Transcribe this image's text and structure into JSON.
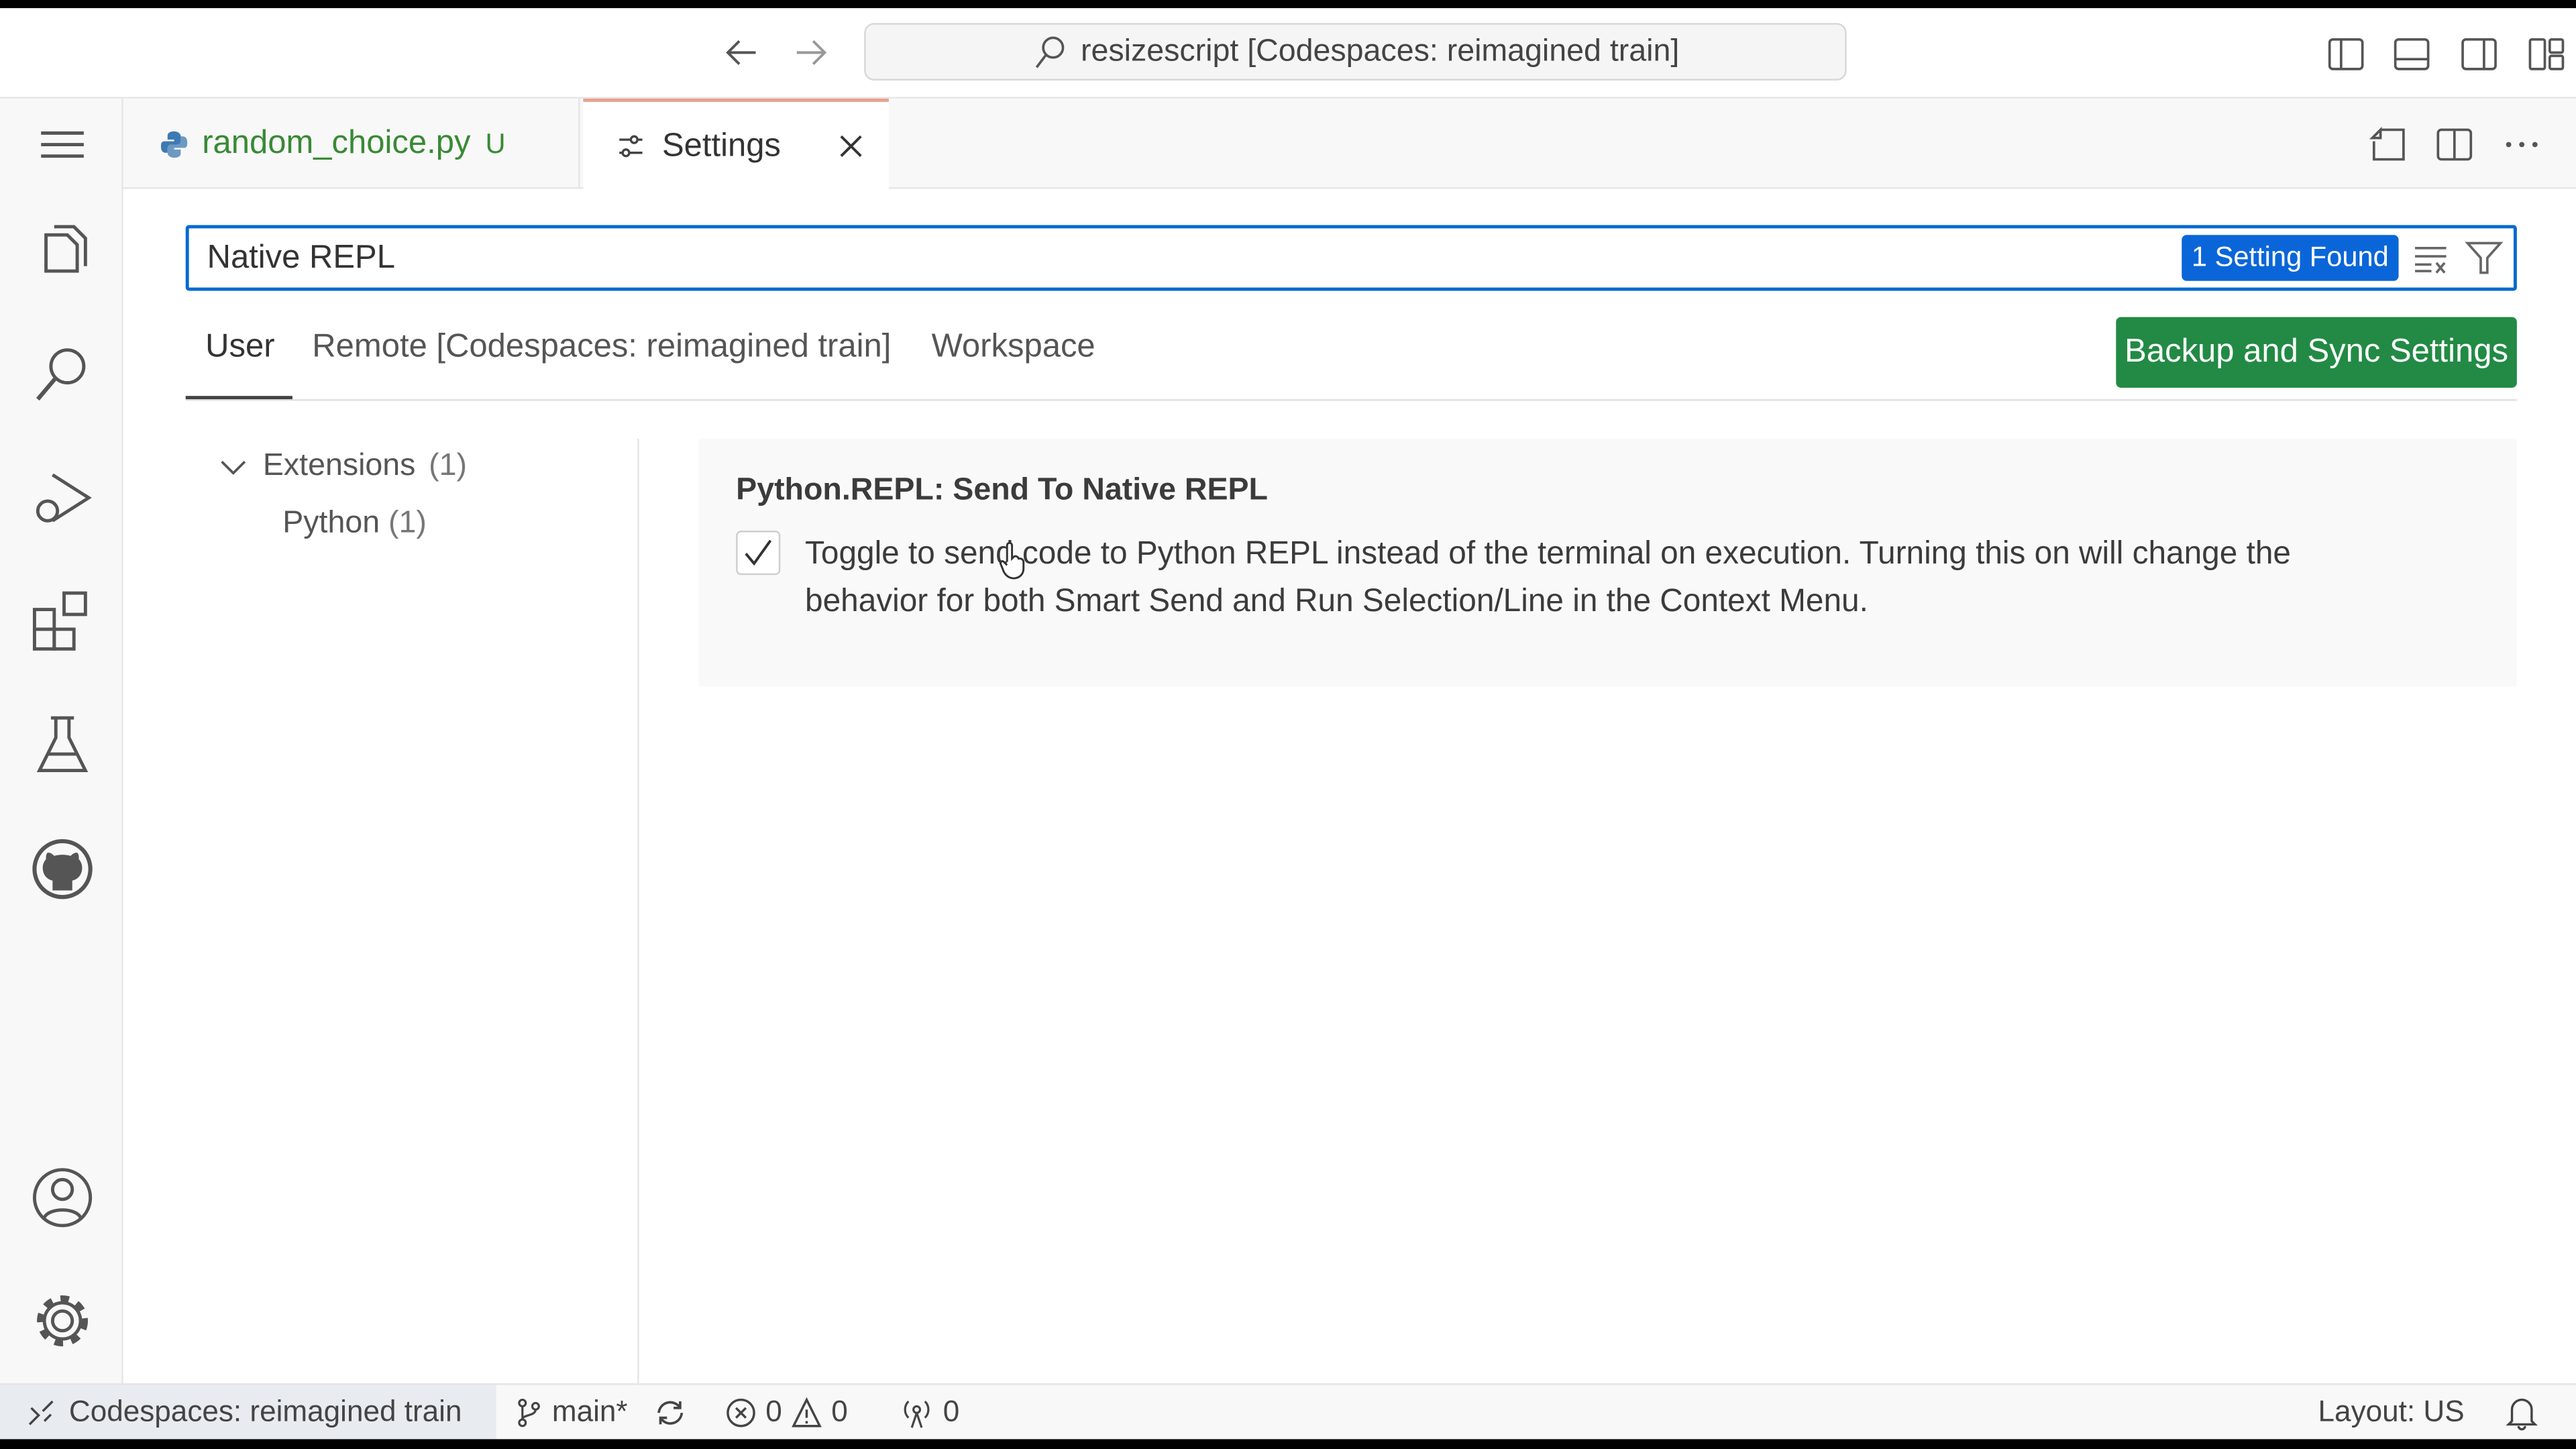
{
  "titlebar": {
    "command_center": "resizescript [Codespaces: reimagined train]"
  },
  "activity_bar": {
    "items": [
      "menu-icon",
      "explorer-icon",
      "search-icon",
      "run-debug-icon",
      "extensions-icon",
      "testing-icon",
      "github-icon",
      "accounts-icon",
      "manage-gear-icon"
    ]
  },
  "tabs": [
    {
      "label": "random_choice.py",
      "badge": "U",
      "icon": "python-icon",
      "color": "#388a34"
    },
    {
      "label": "Settings",
      "icon": "settings-sliders-icon",
      "active": true
    }
  ],
  "settings": {
    "search_value": "Native REPL",
    "result_badge": "1 Setting Found",
    "scope_tabs": [
      "User",
      "Remote [Codespaces: reimagined train]",
      "Workspace"
    ],
    "active_scope": "User",
    "backup_button": "Backup and Sync Settings",
    "toc": {
      "group": "Extensions",
      "group_count": "(1)",
      "child": "Python",
      "child_count": "(1)"
    },
    "setting": {
      "title": "Python.REPL: Send To Native REPL",
      "description": "Toggle to send code to Python REPL instead of the terminal on execution. Turning this on will change the behavior for both Smart Send and Run Selection/Line in the Context Menu.",
      "checked": true
    }
  },
  "statusbar": {
    "remote": "Codespaces: reimagined train",
    "branch": "main*",
    "errors": "0",
    "warnings": "0",
    "ports": "0",
    "layout": "Layout: US"
  },
  "colors": {
    "accent": "#0069d1",
    "badge": "#0a66d8",
    "backup": "#228a44"
  }
}
